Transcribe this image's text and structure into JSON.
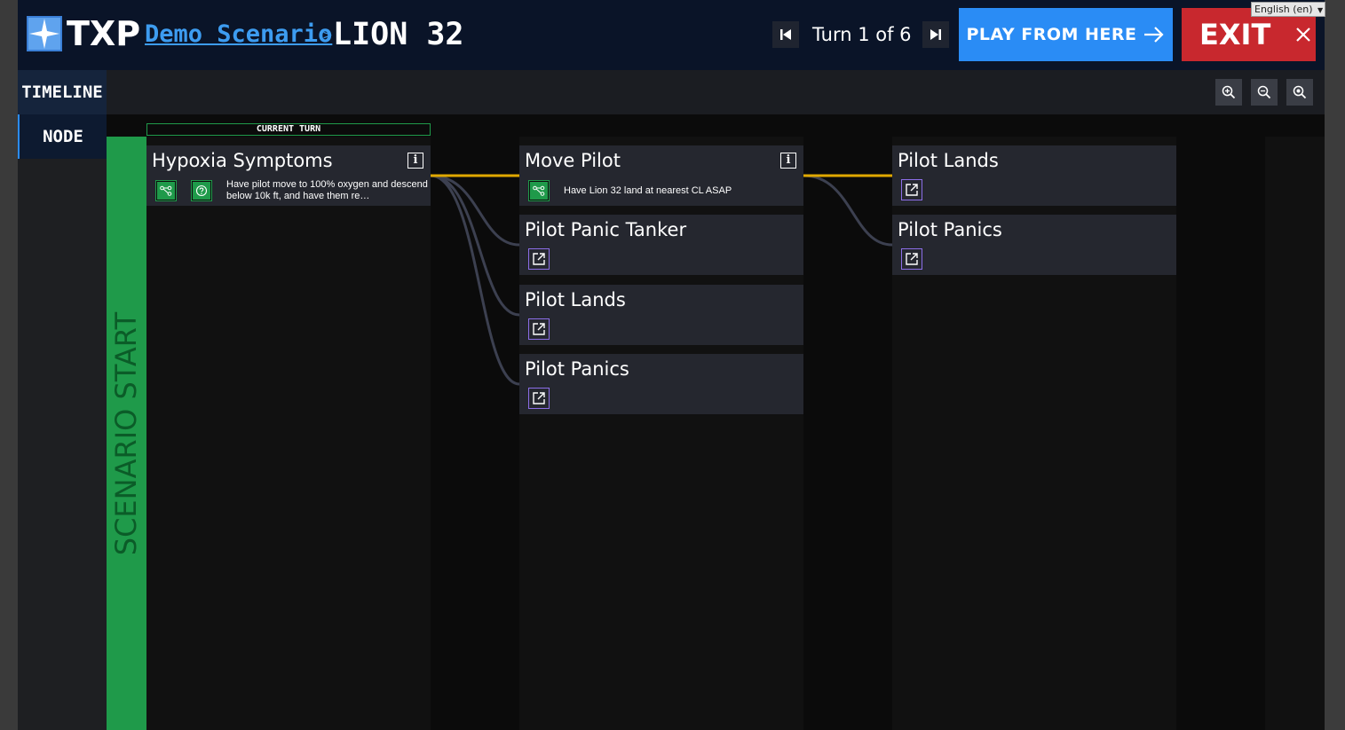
{
  "header": {
    "brand": "TXP",
    "breadcrumb_link": "Demo Scenario",
    "breadcrumb_separator": ">",
    "scenario_name": "LION 32",
    "turn_label": "Turn 1 of 6",
    "play_label": "PLAY FROM HERE",
    "exit_label": "EXIT"
  },
  "language": {
    "selected": "English (en)"
  },
  "tabs": {
    "timeline": "TIMELINE",
    "node": "NODE"
  },
  "canvas": {
    "current_turn_label": "CURRENT TURN",
    "start_label": "SCENARIO START"
  },
  "turn1": {
    "node": {
      "title": "Hypoxia Symptoms",
      "description": "Have pilot move to 100% oxygen and descend below 10k ft, and have them re…"
    }
  },
  "turn2": {
    "nodes": [
      {
        "title": "Move Pilot",
        "description": "Have Lion 32 land at nearest CL ASAP"
      },
      {
        "title": "Pilot Panic Tanker"
      },
      {
        "title": "Pilot Lands"
      },
      {
        "title": "Pilot Panics"
      }
    ]
  },
  "turn3": {
    "nodes": [
      {
        "title": "Pilot Lands"
      },
      {
        "title": "Pilot Panics"
      }
    ]
  },
  "colors": {
    "accent_blue": "#2a8cf5",
    "exit_red": "#c8282e",
    "start_green": "#1f9a4a",
    "selected_path": "#e0a800"
  }
}
